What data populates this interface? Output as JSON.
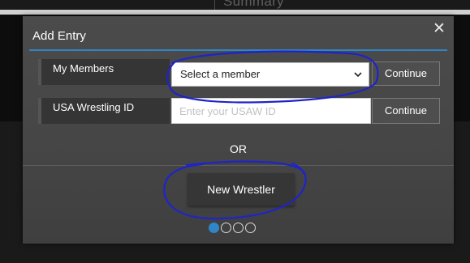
{
  "background": {
    "header_text": "Summary"
  },
  "modal": {
    "title": "Add Entry",
    "close_icon": "close-icon",
    "rows": [
      {
        "label": "My Members",
        "control": "select",
        "selected_value": "Select a member",
        "button_label": "Continue"
      },
      {
        "label": "USA Wrestling ID",
        "control": "input",
        "value": "",
        "placeholder": "Enter your USAW ID",
        "button_label": "Continue"
      }
    ],
    "or_text": "OR",
    "new_wrestler_label": "New Wrestler",
    "pager": {
      "total": 4,
      "active": 1
    }
  },
  "colors": {
    "accent": "#2f86c8",
    "modal_bg": "#464646",
    "annotation": "#1f24c8"
  }
}
